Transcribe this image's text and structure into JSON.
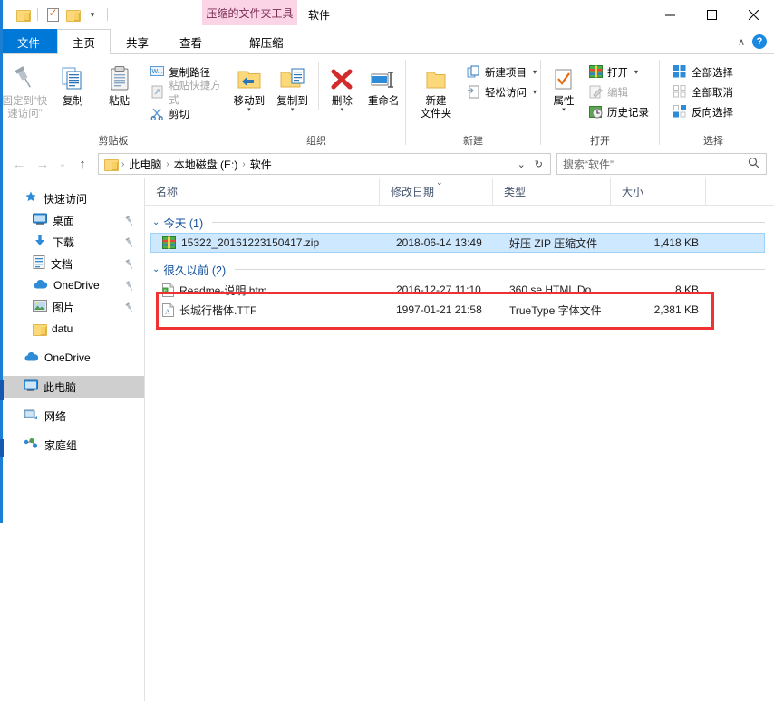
{
  "window": {
    "title": "软件",
    "contextual_tab_group": "压缩的文件夹工具",
    "minimize": "最小化",
    "maximize": "最大化",
    "close": "关闭"
  },
  "quick_access_toolbar": {
    "items": [
      {
        "name": "properties-folder",
        "icon": "folder-icon"
      },
      {
        "name": "properties",
        "icon": "properties-icon"
      },
      {
        "name": "new-folder",
        "icon": "folder-icon"
      },
      {
        "name": "customize",
        "icon": "chevron-down-icon",
        "glyph": "▾"
      }
    ]
  },
  "tabs": [
    {
      "id": "file",
      "label": "文件",
      "state": "file"
    },
    {
      "id": "home",
      "label": "主页",
      "state": "active"
    },
    {
      "id": "share",
      "label": "共享",
      "state": "normal"
    },
    {
      "id": "view",
      "label": "查看",
      "state": "normal"
    },
    {
      "id": "extract",
      "label": "解压缩",
      "state": "contextual"
    }
  ],
  "ribbon_controls": {
    "collapse": "∧",
    "help": "?"
  },
  "ribbon": {
    "groups": [
      {
        "id": "clipboard",
        "label": "剪贴板",
        "big_buttons": [
          {
            "label": "固定到“快\n速访问”",
            "label_l1": "固定到“快",
            "label_l2": "速访问”",
            "icon": "pin-icon",
            "disabled": true
          },
          {
            "label": "复制",
            "icon": "copy-icon",
            "disabled": false
          },
          {
            "label": "粘贴",
            "icon": "paste-icon",
            "disabled": false,
            "has_caret": false
          }
        ],
        "small_buttons": [
          {
            "label": "复制路径",
            "icon": "copy-path-icon",
            "disabled": false
          },
          {
            "label": "粘贴快捷方式",
            "icon": "paste-shortcut-icon",
            "disabled": true
          },
          {
            "label": "剪切",
            "icon": "scissors-icon",
            "disabled": false
          }
        ]
      },
      {
        "id": "organize",
        "label": "组织",
        "big_buttons": [
          {
            "label": "移动到",
            "icon": "move-to-icon",
            "has_caret": true
          },
          {
            "label": "复制到",
            "icon": "copy-to-icon",
            "has_caret": true
          },
          {
            "label": "删除",
            "icon": "delete-icon",
            "has_caret": true
          },
          {
            "label": "重命名",
            "icon": "rename-icon",
            "has_caret": false
          }
        ]
      },
      {
        "id": "new",
        "label": "新建",
        "big_buttons": [
          {
            "label": "新建\n文件夹",
            "label_l1": "新建",
            "label_l2": "文件夹",
            "icon": "new-folder-icon"
          }
        ],
        "small_buttons": [
          {
            "label": "新建项目",
            "icon": "new-item-icon",
            "has_caret": true
          },
          {
            "label": "轻松访问",
            "icon": "easy-access-icon",
            "has_caret": true
          }
        ]
      },
      {
        "id": "open",
        "label": "打开",
        "big_buttons": [
          {
            "label": "属性",
            "icon": "properties-icon",
            "has_caret": true
          }
        ],
        "small_buttons": [
          {
            "label": "打开",
            "icon": "open-icon",
            "has_caret": true,
            "disabled": false
          },
          {
            "label": "编辑",
            "icon": "edit-icon",
            "disabled": true
          },
          {
            "label": "历史记录",
            "icon": "history-icon",
            "disabled": false
          }
        ]
      },
      {
        "id": "select",
        "label": "选择",
        "small_buttons": [
          {
            "label": "全部选择",
            "icon": "select-all-icon"
          },
          {
            "label": "全部取消",
            "icon": "select-none-icon"
          },
          {
            "label": "反向选择",
            "icon": "invert-selection-icon"
          }
        ]
      }
    ]
  },
  "address_bar": {
    "back": "←",
    "forward": "→",
    "recent": "⌄",
    "up": "↑",
    "breadcrumbs": [
      {
        "label": "此电脑"
      },
      {
        "label": "本地磁盘 (E:)"
      },
      {
        "label": "软件"
      }
    ],
    "separator": "›",
    "dropdown": "⌄",
    "refresh": "↻"
  },
  "search": {
    "placeholder": "搜索“软件”",
    "icon": "search-icon"
  },
  "nav_pane": {
    "items": [
      {
        "label": "快速访问",
        "icon": "star-pin-icon",
        "level": 0,
        "pinned": false,
        "selected": false
      },
      {
        "label": "桌面",
        "icon": "desktop-icon",
        "level": 1,
        "pinned": true,
        "selected": false
      },
      {
        "label": "下载",
        "icon": "download-icon",
        "level": 1,
        "pinned": true,
        "selected": false
      },
      {
        "label": "文档",
        "icon": "documents-icon",
        "level": 1,
        "pinned": true,
        "selected": false
      },
      {
        "label": "OneDrive",
        "icon": "onedrive-icon",
        "level": 1,
        "pinned": true,
        "selected": false
      },
      {
        "label": "图片",
        "icon": "pictures-icon",
        "level": 1,
        "pinned": true,
        "selected": false
      },
      {
        "label": "datu",
        "icon": "folder-icon",
        "level": 1,
        "pinned": false,
        "selected": false
      },
      {
        "label": "OneDrive",
        "icon": "onedrive-icon",
        "level": 0,
        "pinned": false,
        "selected": false
      },
      {
        "label": "此电脑",
        "icon": "this-pc-icon",
        "level": 0,
        "pinned": false,
        "selected": true
      },
      {
        "label": "网络",
        "icon": "network-icon",
        "level": 0,
        "pinned": false,
        "selected": false
      },
      {
        "label": "家庭组",
        "icon": "homegroup-icon",
        "level": 0,
        "pinned": false,
        "selected": false
      }
    ]
  },
  "file_list": {
    "columns": [
      {
        "key": "name",
        "label": "名称",
        "sorted": false
      },
      {
        "key": "date",
        "label": "修改日期",
        "sorted": true,
        "sort_glyph": "⌄"
      },
      {
        "key": "type",
        "label": "类型",
        "sorted": false
      },
      {
        "key": "size",
        "label": "大小",
        "sorted": false
      }
    ],
    "groups": [
      {
        "header": "今天 (1)",
        "chevron": "⌄",
        "rows": [
          {
            "name": "15322_20161223150417.zip",
            "date": "2018-06-14 13:49",
            "type": "好压 ZIP 压缩文件",
            "size": "1,418 KB",
            "icon": "zip-file-icon",
            "selected": true,
            "highlighted": false
          }
        ]
      },
      {
        "header": "很久以前 (2)",
        "chevron": "⌄",
        "rows": [
          {
            "name": "Readme-说明.htm",
            "date": "2016-12-27 11:10",
            "type": "360 se HTML Do...",
            "size": "8 KB",
            "icon": "html-file-icon",
            "selected": false,
            "highlighted": false
          },
          {
            "name": "长城行楷体.TTF",
            "date": "1997-01-21 21:58",
            "type": "TrueType 字体文件",
            "size": "2,381 KB",
            "icon": "truetype-file-icon",
            "selected": false,
            "highlighted": true
          }
        ]
      }
    ]
  },
  "annotation": {
    "type": "red-rectangle",
    "color": "#ef3232",
    "target": "长城行楷体.TTF"
  },
  "colors": {
    "accent": "#0078d7",
    "selection": "#cde8ff",
    "contextual_tab": "#fbd5e5",
    "group_header": "#15539e",
    "column_header": "#44546e",
    "annotation": "#ef3232"
  }
}
